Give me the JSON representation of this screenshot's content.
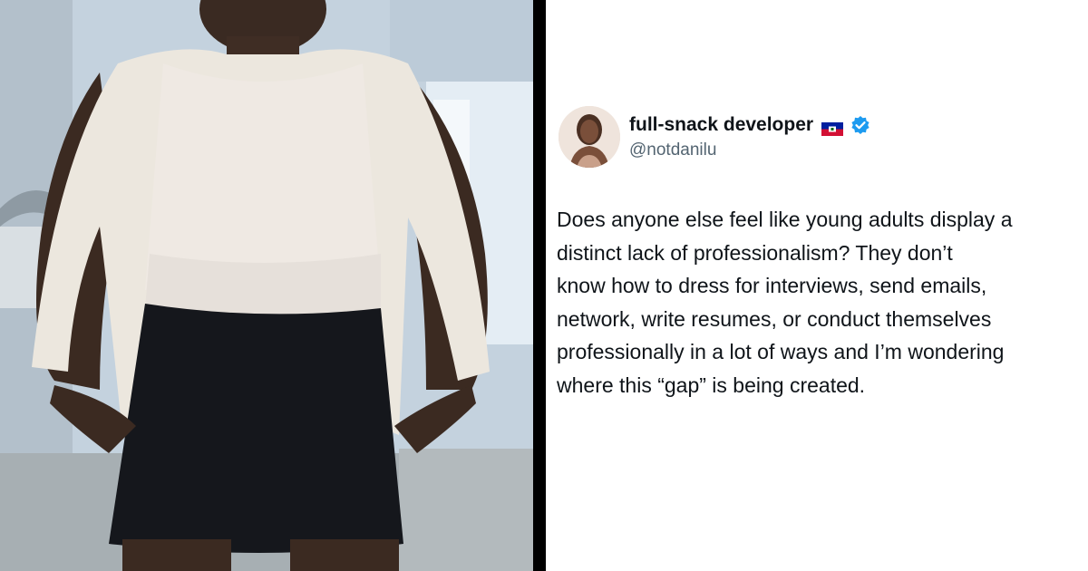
{
  "tweet": {
    "display_name": "full-snack developer",
    "flag": "haiti-flag",
    "verified_badge": "verified-check-icon",
    "handle": "@notdanilu",
    "text": "Does anyone else feel like young adults display a\ndistinct lack of professionalism? They don’t\nknow how to dress for interviews, send emails,\nnetwork, write resumes, or conduct themselves\nprofessionally in a lot of ways and I’m wondering\nwhere this “gap” is being created.",
    "avatar": "profile-photo"
  },
  "photo": {
    "subject": "person-outfit-photo"
  },
  "colors": {
    "text_primary": "#0f1419",
    "text_secondary": "#536471",
    "verified_blue": "#1d9bf0",
    "divider": "#000000"
  }
}
